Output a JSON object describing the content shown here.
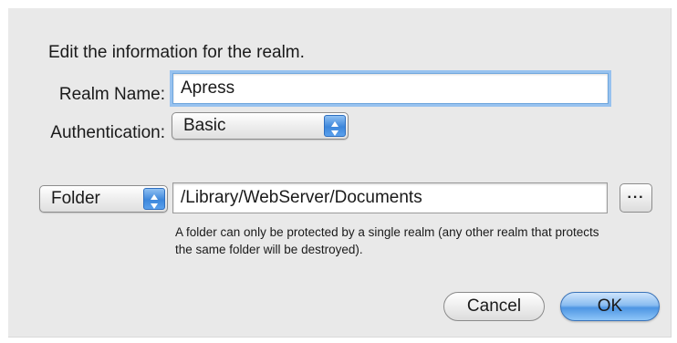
{
  "dialog": {
    "prompt": "Edit the information for the realm.",
    "realm_name": {
      "label": "Realm Name:",
      "value": "Apress"
    },
    "authentication": {
      "label": "Authentication:",
      "selected": "Basic"
    },
    "scope": {
      "selected": "Folder",
      "path": "/Library/WebServer/Documents",
      "browse_label": "···",
      "note": "A folder can only be protected by a single realm (any other realm that protects the same folder will be destroyed)."
    },
    "buttons": {
      "cancel": "Cancel",
      "ok": "OK"
    },
    "colors": {
      "dialog_background": "#e9e9e9",
      "focus_ring": "#97c2ef",
      "default_button": "#4d95e3"
    },
    "icons": {
      "popup_arrows": "up-down-arrows-icon"
    }
  }
}
